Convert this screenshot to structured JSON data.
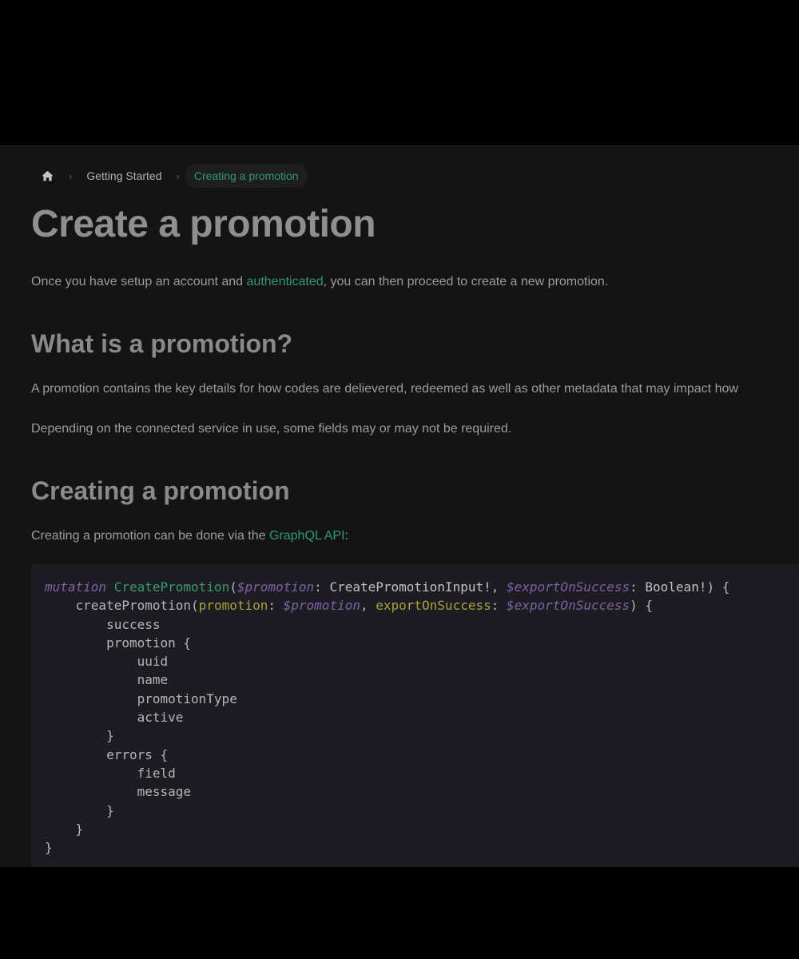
{
  "breadcrumb": {
    "home_icon": "home-icon",
    "items": [
      "Getting Started",
      "Creating a promotion"
    ],
    "separator": "›"
  },
  "title": "Create a promotion",
  "intro": {
    "before": "Once you have setup an account and ",
    "link": "authenticated",
    "after": ", you can then proceed to create a new promotion."
  },
  "section1": {
    "heading": "What is a promotion?",
    "para1": "A promotion contains the key details for how codes are delievered, redeemed as well as other metadata that may impact how",
    "para2": "Depending on the connected service in use, some fields may or may not be required."
  },
  "section2": {
    "heading": "Creating a promotion",
    "para_before": "Creating a promotion can be done via the ",
    "para_link": "GraphQL API",
    "para_after": ":"
  },
  "code": {
    "mutation_kw": "mutation",
    "mutation_name": "CreatePromotion",
    "var_promotion": "$promotion",
    "type_input": "CreatePromotionInput!",
    "var_export": "$exportOnSuccess",
    "type_bool": "Boolean!",
    "field_create": "createPromotion",
    "arg_promotion": "promotion",
    "arg_export": "exportOnSuccess",
    "f_success": "success",
    "f_promotion": "promotion",
    "f_uuid": "uuid",
    "f_name": "name",
    "f_promotionType": "promotionType",
    "f_active": "active",
    "f_errors": "errors",
    "f_field": "field",
    "f_message": "message"
  },
  "colors": {
    "accent": "#2f9a73",
    "background": "#141414",
    "code_background": "#1c1c22"
  }
}
